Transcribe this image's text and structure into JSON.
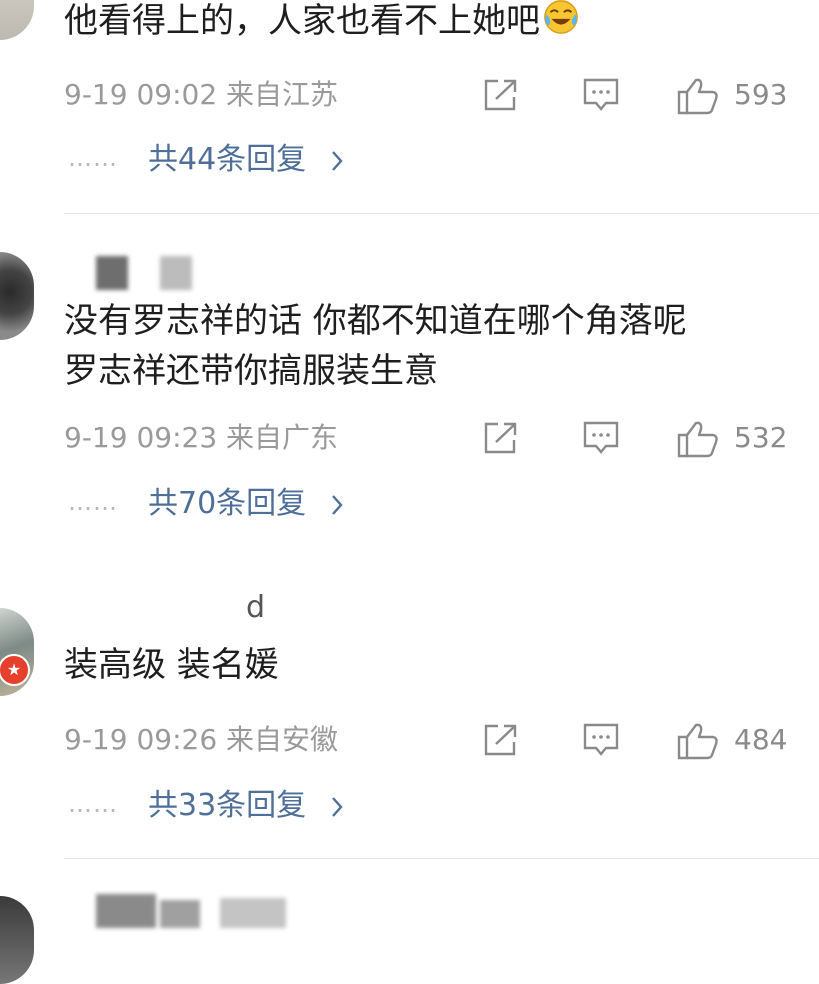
{
  "comments": [
    {
      "text": "他看得上的，人家也看不上她吧",
      "emoji": "laughing-crying-emoji",
      "time_location": "9-19 09:02 来自江苏",
      "likes": "593",
      "replies_label": "共44条回复",
      "dots": "……"
    },
    {
      "text_line1": "没有罗志祥的话 你都不知道在哪个角落呢",
      "text_line2": "罗志祥还带你搞服装生意",
      "time_location": "9-19 09:23 来自广东",
      "likes": "532",
      "replies_label": "共70条回复",
      "dots": "……"
    },
    {
      "username_tail": "d",
      "text": "装高级 装名媛",
      "time_location": "9-19 09:26 来自安徽",
      "likes": "484",
      "replies_label": "共33条回复",
      "dots": "……"
    }
  ],
  "icons": {
    "share": "share-icon",
    "comment": "comment-icon",
    "like": "thumbs-up-icon",
    "verified": "verified-badge-icon",
    "chevron": "chevron-right-icon"
  },
  "colors": {
    "reply_link": "#4e6f99",
    "meta_text": "#9a9a9a",
    "verified_badge": "#e6402c",
    "icon_stroke": "#8a8a8a"
  }
}
